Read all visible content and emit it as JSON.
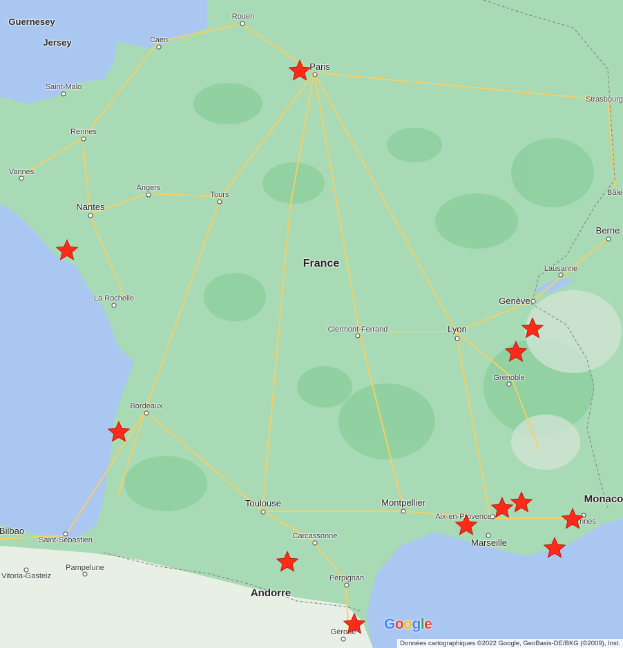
{
  "labels": {
    "guernesey": "Guernesey",
    "jersey": "Jersey",
    "rouen": "Rouen",
    "caen": "Caen",
    "paris": "Paris",
    "saint_malo": "Saint-Malo",
    "strasbourg": "Strasbourg",
    "rennes": "Rennes",
    "vannes": "Vannes",
    "angers": "Angers",
    "tours": "Tours",
    "nantes": "Nantes",
    "bale": "Bâle",
    "berne": "Berne",
    "france": "France",
    "lausanne": "Lausanne",
    "la_rochelle": "La Rochelle",
    "geneve": "Genève",
    "clermont": "Clermont-Ferrand",
    "lyon": "Lyon",
    "grenoble": "Grenoble",
    "bordeaux": "Bordeaux",
    "toulouse": "Toulouse",
    "montpellier": "Montpellier",
    "monaco": "Monaco",
    "aix": "Aix-en-Provence",
    "cannes": "nnes",
    "bilbao": "Bilbao",
    "saint_sebastien": "Saint-Sébastien",
    "carcassonne": "Carcassonne",
    "marseille": "Marseille",
    "vitoria": "Vitoria-Gasteiz",
    "pampelune": "Pampelune",
    "perpignan": "Perpignan",
    "andorre": "Andorre",
    "gerone": "Gérone"
  },
  "markers": [
    {
      "name": "Paris"
    },
    {
      "name": "Pornic"
    },
    {
      "name": "Annecy"
    },
    {
      "name": "Chambéry"
    },
    {
      "name": "Arcachon"
    },
    {
      "name": "Aix-en-Provence"
    },
    {
      "name": "Sainte-Maxime"
    },
    {
      "name": "Cassis"
    },
    {
      "name": "Cannes"
    },
    {
      "name": "Saint-Tropez"
    },
    {
      "name": "Foix"
    },
    {
      "name": "Collioure"
    }
  ],
  "logo": {
    "g1": "G",
    "o1": "o",
    "o2": "o",
    "g2": "g",
    "l": "l",
    "e": "e"
  },
  "colors": {
    "water": "#aac7f2",
    "land": "#a8dab5",
    "forest": "#8fcf9f",
    "road": "#f6cf65",
    "marker": "#ff2a1a"
  },
  "attribution": "Données cartographiques ©2022 Google, GeoBasis-DE/BKG (©2009), Inst."
}
